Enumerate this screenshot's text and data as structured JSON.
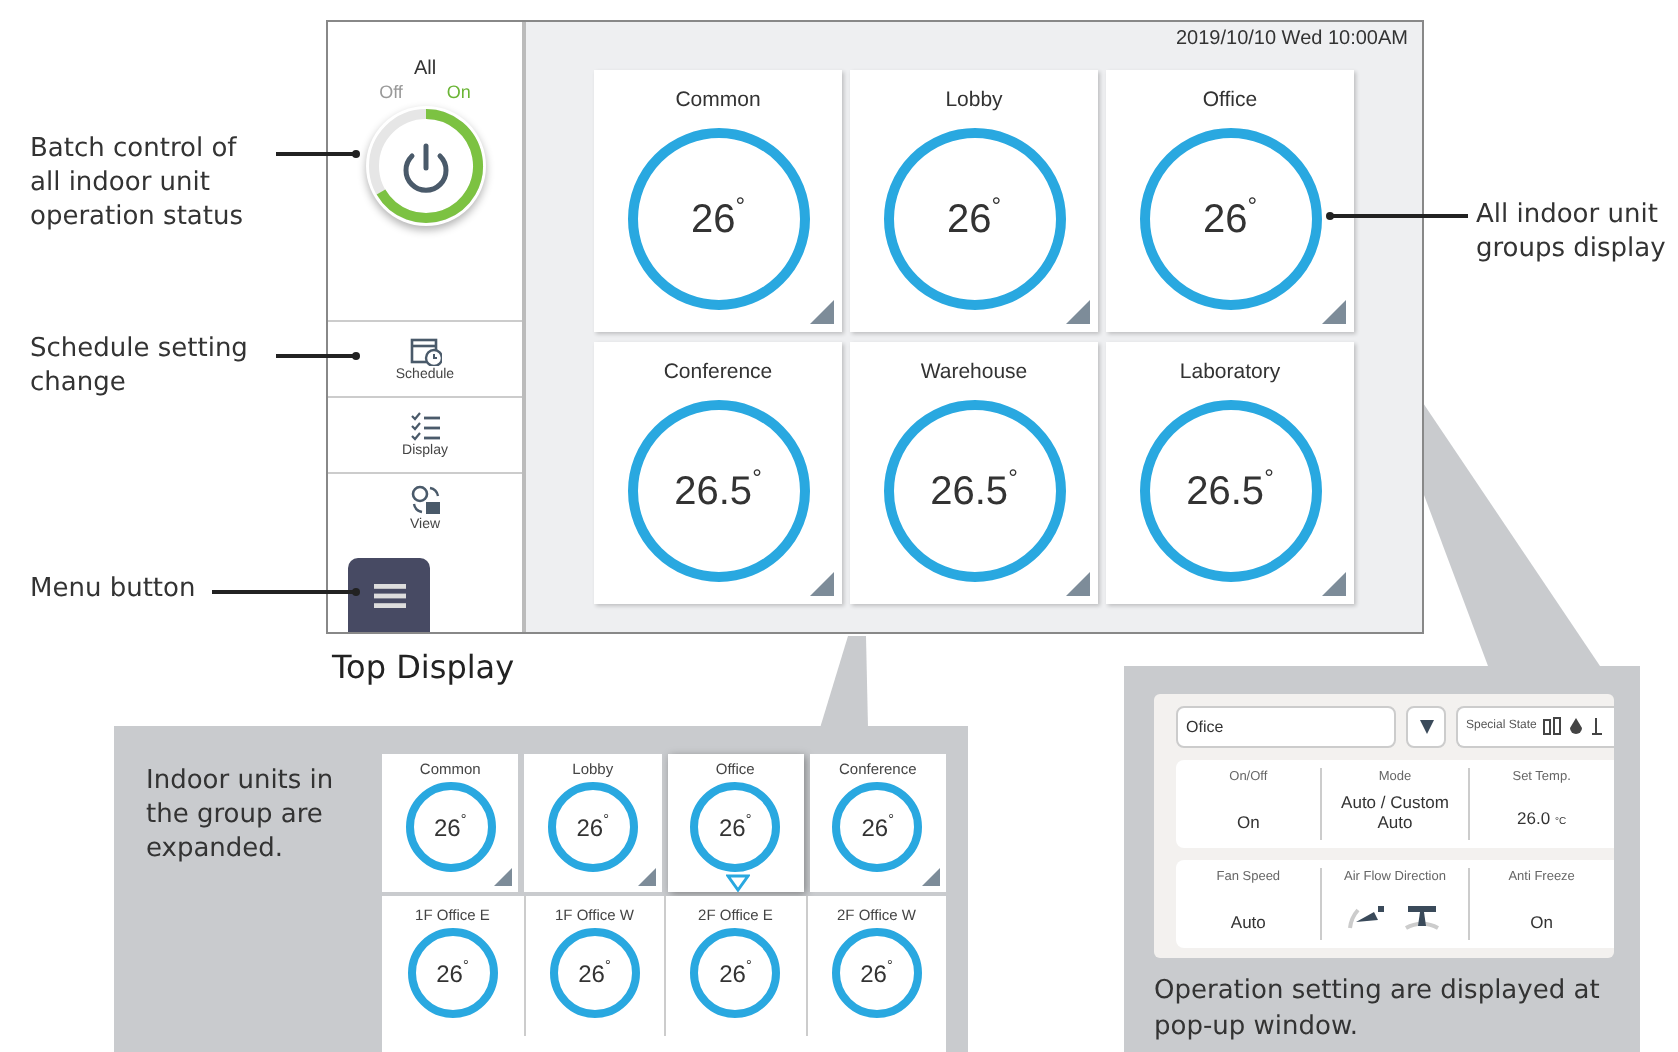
{
  "main_screen": {
    "datetime": "2019/10/10 Wed 10:00AM",
    "all_control": {
      "title": "All",
      "off_label": "Off",
      "on_label": "On",
      "on": true
    },
    "side_menu": [
      {
        "kind": "schedule",
        "label": "Schedule"
      },
      {
        "kind": "display",
        "label": "Display"
      },
      {
        "kind": "view",
        "label": "View"
      }
    ],
    "groups": [
      {
        "name": "Common",
        "temp": "26$^{°}$"
      },
      {
        "name": "Lobby",
        "temp": "26$^{°}$"
      },
      {
        "name": "Office",
        "temp": "26$^{°}$"
      },
      {
        "name": "Conference",
        "temp": "26.5$^{°}$"
      },
      {
        "name": "Warehouse",
        "temp": "26.5$^{°}$"
      },
      {
        "name": "Laboratory",
        "temp": "26.5$^{°}$"
      }
    ]
  },
  "callouts": [
    {
      "text": "Batch control of all indoor unit operation status"
    },
    {
      "text": "Schedule setting change"
    },
    {
      "text": "Menu button"
    },
    {
      "text": "All indoor unit groups display"
    }
  ],
  "caption": "Top Display",
  "expanded_panel": {
    "caption": "Indoor units in the group are expanded.",
    "groups": [
      {
        "name": "Common",
        "temp": "26$^{°}$",
        "selected": false
      },
      {
        "name": "Lobby",
        "temp": "26$^{°}$",
        "selected": false
      },
      {
        "name": "Office",
        "temp": "26$^{°}$",
        "selected": true
      },
      {
        "name": "Conference",
        "temp": "26$^{°}$",
        "selected": false
      }
    ],
    "units": [
      {
        "name": "1F Office E",
        "temp": "26$^{°}$"
      },
      {
        "name": "1F Office W",
        "temp": "26$^{°}$"
      },
      {
        "name": "2F Office E",
        "temp": "26$^{°}$"
      },
      {
        "name": "2F Office W",
        "temp": "26$^{°}$"
      }
    ]
  },
  "popup_panel": {
    "group_field": "Ofice",
    "special_state_label": "Special State",
    "settings": [
      [
        {
          "kind": "text",
          "label": "On/Off",
          "value": "On"
        },
        {
          "kind": "text",
          "label": "Mode",
          "value": "Auto / Custom Auto"
        },
        {
          "kind": "temp",
          "label": "Set Temp.",
          "value": "26.0",
          "unit": "°C"
        }
      ],
      [
        {
          "kind": "text",
          "label": "Fan Speed",
          "value": "Auto"
        },
        {
          "kind": "airflow",
          "label": "Air Flow Direction"
        },
        {
          "kind": "text",
          "label": "Anti Freeze",
          "value": "On"
        }
      ]
    ],
    "caption": "Operation setting are displayed at pop-up window."
  }
}
